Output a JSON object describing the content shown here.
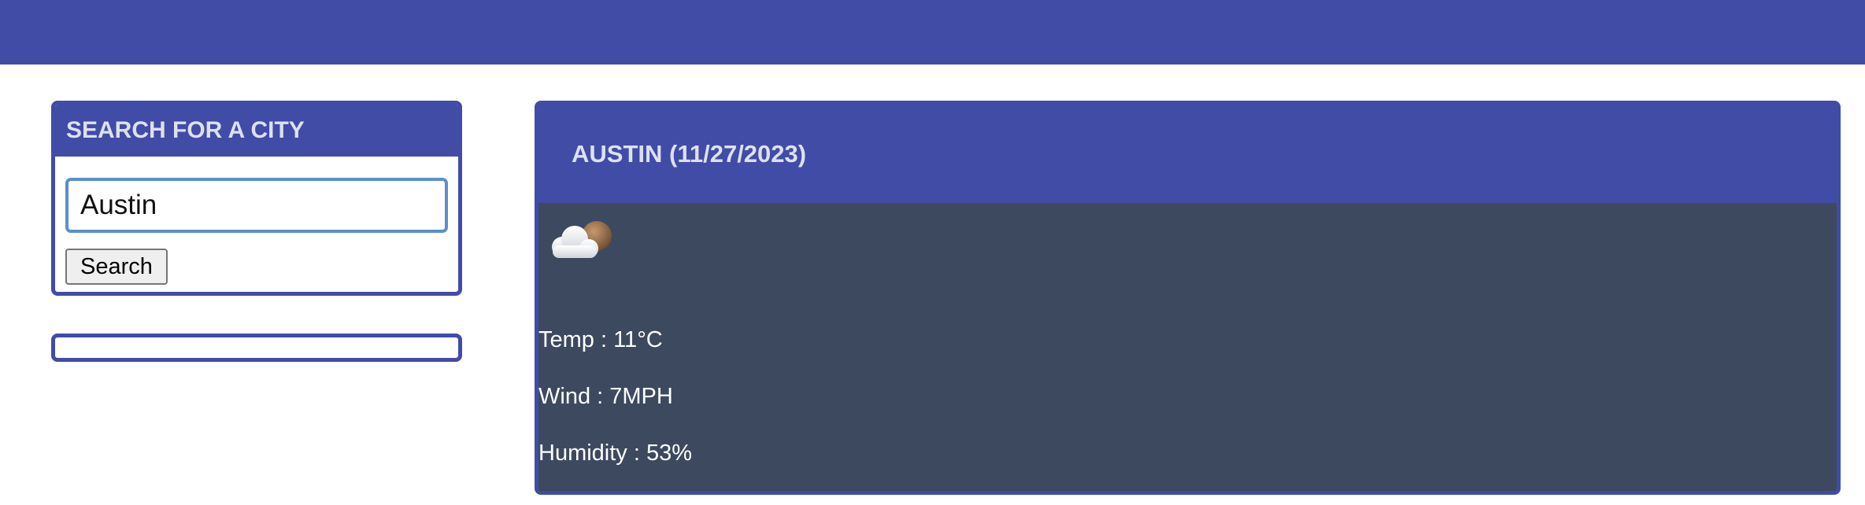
{
  "search_panel": {
    "title": "SEARCH FOR A CITY",
    "input_value": "Austin",
    "button_label": "Search"
  },
  "history": {
    "items": []
  },
  "current_weather": {
    "title": "AUSTIN (11/27/2023)",
    "icon": "cloud-icon",
    "temp": "Temp : 11°C",
    "wind": "Wind : 7MPH",
    "humidity": "Humidity : 53%"
  },
  "colors": {
    "primary": "#404ca6",
    "header_text": "#dde0f0",
    "weather_bg": "#3d495f",
    "input_border": "#5b8ed0"
  }
}
